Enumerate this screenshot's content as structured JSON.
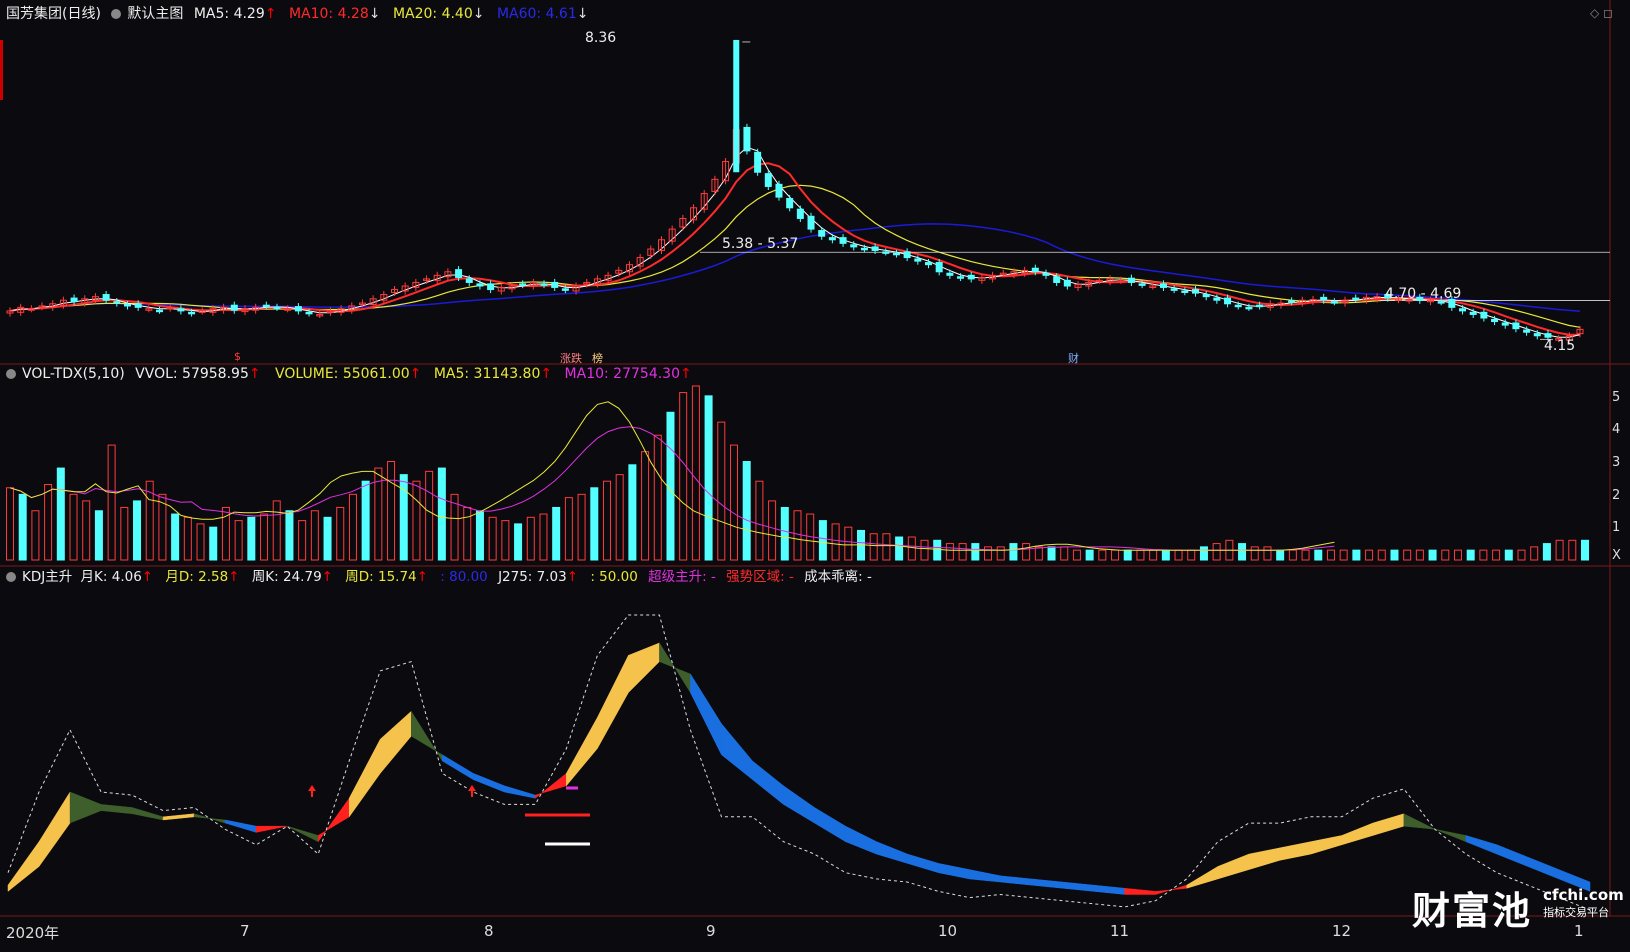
{
  "main_header": {
    "stock": "国芳集团(日线)",
    "template": "默认主图",
    "ma5": "MA5: 4.29",
    "ma10": "MA10: 4.28",
    "ma20": "MA20: 4.40",
    "ma60": "MA60: 4.61"
  },
  "vol_header": {
    "name": "VOL-TDX(5,10)",
    "vvol": "VVOL: 57958.95",
    "volume": "VOLUME: 55061.00",
    "ma5": "MA5: 31143.80",
    "ma10": "MA10: 27754.30"
  },
  "kdj_header": {
    "name": "KDJ主升",
    "yk": "月K: 4.06",
    "yd": "月D: 2.58",
    "wk": "周K: 24.79",
    "wd": "周D: 15.74",
    "l80": ": 80.00",
    "j275": "J275: 7.03",
    "l50": ": 50.00",
    "super": "超级主升: -",
    "strong": "强势区域: -",
    "cost": "成本乖离: -"
  },
  "price_annotations": {
    "high": "8.36",
    "mid": "5.38 - 5.37",
    "right": "4.70 - 4.69",
    "low": "4.15"
  },
  "markers": {
    "s": "$",
    "limit": "涨跌",
    "bang": "榜",
    "cai": "财"
  },
  "x_axis": [
    "2020年",
    "7",
    "8",
    "9",
    "10",
    "11",
    "12",
    "1"
  ],
  "vol_ticks": [
    "5",
    "4",
    "3",
    "2",
    "1",
    "X"
  ],
  "watermark": {
    "cn": "财富池",
    "domain": "cfchi.com",
    "sub": "指标交易平台"
  },
  "colors": {
    "up": "#ff3b3b",
    "down": "#54ffff",
    "ma5": "#ffffff",
    "ma10": "#ff2a2a",
    "ma20": "#e8e83a",
    "ma60": "#1a1ad8"
  },
  "chart_data": [
    {
      "type": "candlestick",
      "title": "国芳集团(日线)",
      "price_range": [
        4.0,
        8.5
      ],
      "high_price": 8.36,
      "low_price": 4.15,
      "close": [
        4.55,
        4.6,
        4.58,
        4.62,
        4.65,
        4.7,
        4.68,
        4.72,
        4.75,
        4.7,
        4.66,
        4.62,
        4.6,
        4.58,
        4.56,
        4.6,
        4.55,
        4.52,
        4.55,
        4.58,
        4.6,
        4.56,
        4.58,
        4.6,
        4.62,
        4.6,
        4.58,
        4.55,
        4.52,
        4.5,
        4.55,
        4.58,
        4.62,
        4.66,
        4.72,
        4.78,
        4.85,
        4.9,
        4.95,
        5.0,
        5.05,
        5.1,
        5.02,
        4.95,
        4.9,
        4.85,
        4.88,
        4.9,
        4.92,
        4.95,
        4.92,
        4.88,
        4.85,
        4.9,
        4.95,
        5.0,
        5.05,
        5.12,
        5.2,
        5.3,
        5.42,
        5.55,
        5.7,
        5.85,
        6.0,
        6.2,
        6.4,
        6.65,
        7.1,
        6.8,
        6.5,
        6.3,
        6.15,
        6.0,
        5.85,
        5.7,
        5.6,
        5.55,
        5.5,
        5.45,
        5.42,
        5.4,
        5.38,
        5.35,
        5.3,
        5.25,
        5.2,
        5.1,
        5.05,
        5.02,
        5.0,
        5.02,
        5.05,
        5.08,
        5.1,
        5.12,
        5.1,
        5.05,
        4.95,
        4.9,
        4.92,
        4.95,
        4.98,
        5.0,
        4.98,
        4.95,
        4.92,
        4.9,
        4.88,
        4.85,
        4.82,
        4.8,
        4.75,
        4.7,
        4.65,
        4.62,
        4.6,
        4.62,
        4.65,
        4.66,
        4.68,
        4.7,
        4.71,
        4.7,
        4.68,
        4.7,
        4.72,
        4.74,
        4.75,
        4.73,
        4.72,
        4.71,
        4.7,
        4.7,
        4.68,
        4.6,
        4.55,
        4.5,
        4.45,
        4.4,
        4.35,
        4.3,
        4.25,
        4.2,
        4.18,
        4.16,
        4.2,
        4.29
      ]
    },
    {
      "type": "bar",
      "title": "VOL-TDX(5,10)",
      "series": [
        {
          "name": "VOLUME",
          "values": [
            2.2,
            2.0,
            1.5,
            2.3,
            2.8,
            2.0,
            1.8,
            1.5,
            3.5,
            1.6,
            1.8,
            2.4,
            2.0,
            1.4,
            1.3,
            1.1,
            1.0,
            1.6,
            1.2,
            1.3,
            1.4,
            1.8,
            1.5,
            1.2,
            1.5,
            1.3,
            1.6,
            2.0,
            2.4,
            2.8,
            3.0,
            2.6,
            2.4,
            2.7,
            2.8,
            2.0,
            1.6,
            1.5,
            1.3,
            1.2,
            1.1,
            1.3,
            1.4,
            1.6,
            1.9,
            2.0,
            2.2,
            2.4,
            2.6,
            2.9,
            3.3,
            3.8,
            4.5,
            5.1,
            5.3,
            5.0,
            4.2,
            3.5,
            3.0,
            2.4,
            1.8,
            1.6,
            1.5,
            1.4,
            1.2,
            1.1,
            1.0,
            0.9,
            0.8,
            0.8,
            0.7,
            0.7,
            0.6,
            0.6,
            0.5,
            0.5,
            0.5,
            0.4,
            0.4,
            0.5,
            0.5,
            0.4,
            0.4,
            0.4,
            0.3,
            0.3,
            0.3,
            0.3,
            0.3,
            0.3,
            0.3,
            0.3,
            0.3,
            0.3,
            0.4,
            0.5,
            0.6,
            0.5,
            0.4,
            0.4,
            0.3,
            0.3,
            0.3,
            0.3,
            0.3,
            0.3,
            0.3,
            0.3,
            0.3,
            0.3,
            0.3,
            0.3,
            0.3,
            0.3,
            0.3,
            0.3,
            0.3,
            0.3,
            0.3,
            0.3,
            0.4,
            0.5,
            0.6,
            0.6,
            0.6
          ]
        },
        {
          "name": "MA5",
          "values": []
        },
        {
          "name": "MA10",
          "values": []
        }
      ]
    },
    {
      "type": "line",
      "title": "KDJ主升",
      "series": [
        {
          "name": "月K",
          "values": [
            8,
            22,
            38,
            34,
            33,
            30,
            31,
            28,
            25,
            27,
            22,
            36,
            55,
            64,
            48,
            42,
            38,
            36,
            44,
            62,
            82,
            86,
            70,
            50,
            42,
            34,
            28,
            22,
            18,
            15,
            12,
            10,
            9,
            8,
            7,
            6,
            5,
            5,
            8,
            14,
            18,
            20,
            22,
            24,
            28,
            31,
            26,
            22,
            18,
            14,
            10,
            6
          ]
        },
        {
          "name": "月D",
          "values": [
            6,
            14,
            28,
            32,
            31,
            29,
            30,
            29,
            27,
            27,
            24,
            30,
            44,
            56,
            50,
            44,
            40,
            37,
            40,
            52,
            70,
            80,
            76,
            60,
            48,
            40,
            33,
            27,
            22,
            18,
            15,
            13,
            11,
            10,
            9,
            8,
            7,
            6,
            7,
            10,
            13,
            16,
            18,
            21,
            24,
            27,
            26,
            24,
            21,
            17,
            13,
            9
          ]
        }
      ]
    }
  ]
}
